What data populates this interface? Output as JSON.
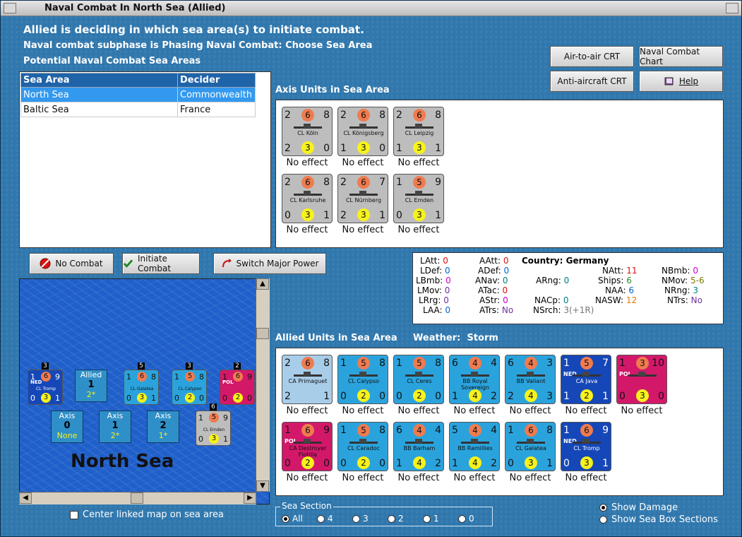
{
  "window": {
    "title": "Naval Combat In North Sea (Allied)"
  },
  "headings": {
    "line1": "Allied is deciding in which sea area(s) to initiate combat.",
    "line2": "Naval combat subphase is Phasing Naval Combat: Choose Sea Area",
    "line3": "Potential Naval Combat Sea Areas"
  },
  "charts": {
    "air_to_air": "Air-to-air CRT",
    "naval_combat": "Naval Combat Chart",
    "anti_aircraft": "Anti-aircraft CRT",
    "help": "Help"
  },
  "sea_table": {
    "headers": [
      "Sea Area",
      "Decider"
    ],
    "rows": [
      {
        "area": "North Sea",
        "decider": "Commonwealth",
        "selected": true
      },
      {
        "area": "Baltic Sea",
        "decider": "France",
        "selected": false
      }
    ]
  },
  "axis_panel": {
    "label": "Axis Units in Sea Area",
    "units": [
      {
        "name": "CL Köln",
        "tl": "2",
        "tc": "6",
        "tr": "8",
        "bl": "2",
        "bc": "3",
        "br": "0",
        "effect": "No effect"
      },
      {
        "name": "CL Königsberg",
        "tl": "2",
        "tc": "6",
        "tr": "8",
        "bl": "1",
        "bc": "3",
        "br": "0",
        "effect": "No effect"
      },
      {
        "name": "CL Leipzig",
        "tl": "2",
        "tc": "6",
        "tr": "8",
        "bl": "1",
        "bc": "3",
        "br": "1",
        "effect": "No effect"
      },
      {
        "name": "CL Karlsruhe",
        "tl": "2",
        "tc": "6",
        "tr": "8",
        "bl": "0",
        "bc": "3",
        "br": "1",
        "effect": "No effect"
      },
      {
        "name": "CL Nürnberg",
        "tl": "2",
        "tc": "6",
        "tr": "7",
        "bl": "2",
        "bc": "3",
        "br": "1",
        "effect": "No effect"
      },
      {
        "name": "CL Emden",
        "tl": "1",
        "tc": "5",
        "tr": "9",
        "bl": "0",
        "bc": "3",
        "br": "1",
        "effect": "No effect"
      }
    ]
  },
  "actions": {
    "no_combat": "No Combat",
    "initiate": "Initiate Combat",
    "switch": "Switch Major Power"
  },
  "stats": {
    "LAtt": "0",
    "LDef": "0",
    "LBmb": "0",
    "LMov": "0",
    "LRrg": "0",
    "LAA": "0",
    "AAtt": "0",
    "ADef": "0",
    "ANav": "0",
    "ATac": "0",
    "AStr": "0",
    "ATrs": "No",
    "country_label": "Country:",
    "country": "Germany",
    "ARng": "0",
    "NACp": "0",
    "NSrch": "3(+1R)",
    "NAtt": "11",
    "Ships": "6",
    "NAA": "6",
    "NASW": "12",
    "NBmb": "0",
    "NMov": "5-6",
    "NRng": "3",
    "NTrs": "No"
  },
  "allied_panel": {
    "label": "Allied Units in Sea Area",
    "weather_label": "Weather:",
    "weather": "Storm",
    "units": [
      {
        "name": "CA Primaguet",
        "tl": "2",
        "tc": "6",
        "tr": "8",
        "bl": "2",
        "bc": "",
        "br": "1",
        "effect": "No effect",
        "style": "lightblue"
      },
      {
        "name": "CL Calypso",
        "tl": "1",
        "tc": "5",
        "tr": "8",
        "bl": "0",
        "bc": "2",
        "br": "0",
        "effect": "No effect",
        "style": "blue"
      },
      {
        "name": "CL Ceres",
        "tl": "1",
        "tc": "5",
        "tr": "8",
        "bl": "0",
        "bc": "2",
        "br": "0",
        "effect": "No effect",
        "style": "blue"
      },
      {
        "name": "BB Royal Sovereign",
        "tl": "6",
        "tc": "4",
        "tr": "4",
        "bl": "1",
        "bc": "4",
        "br": "2",
        "effect": "No effect",
        "style": "blue"
      },
      {
        "name": "BB Valiant",
        "tl": "6",
        "tc": "4",
        "tr": "3",
        "bl": "2",
        "bc": "4",
        "br": "3",
        "effect": "No effect",
        "style": "blue"
      },
      {
        "name": "CA Java",
        "tl": "1",
        "tc": "5",
        "tr": "7",
        "bl": "1",
        "bc": "2",
        "br": "1",
        "effect": "No effect",
        "style": "darkblue",
        "nation": "NED"
      },
      {
        "name": "",
        "tl": "1",
        "tc": "3",
        "tr": "10",
        "bl": "0",
        "bc": "3",
        "br": "0",
        "effect": "No effect",
        "style": "magenta",
        "nation": "POL"
      },
      {
        "name": "CA Destroyer Flotilla",
        "tl": "1",
        "tc": "6",
        "tr": "9",
        "bl": "0",
        "bc": "2",
        "br": "0",
        "effect": "No effect",
        "style": "magenta",
        "nation": "POL"
      },
      {
        "name": "CL Caradoc",
        "tl": "1",
        "tc": "5",
        "tr": "8",
        "bl": "0",
        "bc": "2",
        "br": "0",
        "effect": "No effect",
        "style": "blue"
      },
      {
        "name": "BB Barham",
        "tl": "6",
        "tc": "4",
        "tr": "4",
        "bl": "1",
        "bc": "4",
        "br": "2",
        "effect": "No effect",
        "style": "blue"
      },
      {
        "name": "BB Ramillies",
        "tl": "5",
        "tc": "4",
        "tr": "4",
        "bl": "1",
        "bc": "4",
        "br": "2",
        "effect": "No effect",
        "style": "blue"
      },
      {
        "name": "CL Galatea",
        "tl": "1",
        "tc": "6",
        "tr": "8",
        "bl": "0",
        "bc": "3",
        "br": "1",
        "effect": "No effect",
        "style": "blue"
      },
      {
        "name": "CL Tromp",
        "tl": "1",
        "tc": "6",
        "tr": "9",
        "bl": "0",
        "bc": "3",
        "br": "1",
        "effect": "No effect",
        "style": "darkblue",
        "nation": "NED"
      }
    ]
  },
  "map": {
    "title": "North Sea",
    "allied_box": {
      "label": "Allied",
      "num": "1",
      "sub": "2*"
    },
    "axis_boxes": [
      {
        "label": "Axis",
        "num": "0",
        "sub": "None"
      },
      {
        "label": "Axis",
        "num": "1",
        "sub": "2*"
      },
      {
        "label": "Axis",
        "num": "2",
        "sub": "1*"
      }
    ],
    "stack_counts": [
      "3",
      "5",
      "3",
      "2",
      "6"
    ],
    "center_checkbox": "Center linked map on sea area"
  },
  "sea_section": {
    "legend": "Sea Section",
    "options": [
      "All",
      "4",
      "3",
      "2",
      "1",
      "0"
    ]
  },
  "display_options": {
    "show_damage": "Show Damage",
    "show_boxes": "Show Sea Box Sections"
  }
}
